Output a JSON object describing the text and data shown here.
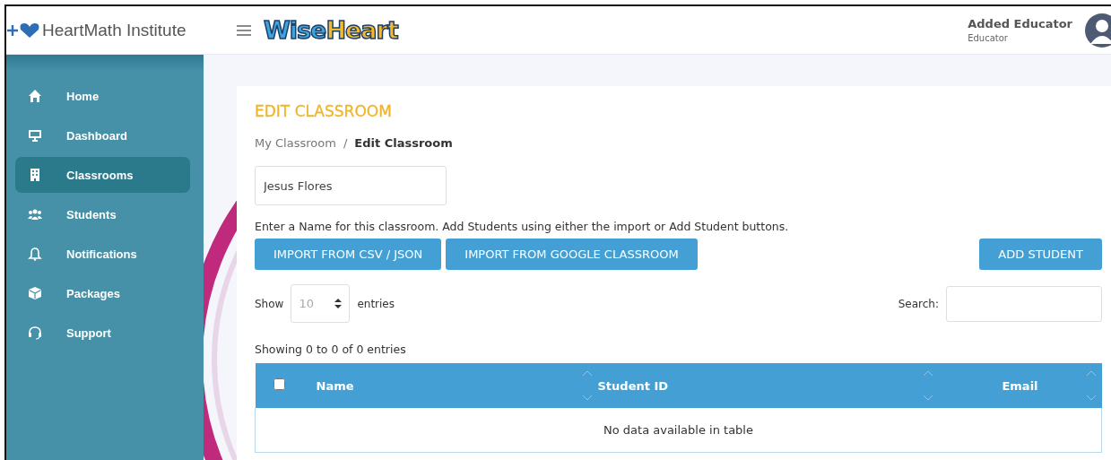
{
  "header": {
    "brand": "HeartMath Institute",
    "app_logo": {
      "first": "Wise",
      "second": "Heart"
    },
    "user": {
      "name": "Added Educator",
      "role": "Educator"
    }
  },
  "sidebar": {
    "items": [
      {
        "label": "Home",
        "selected": false
      },
      {
        "label": "Dashboard",
        "selected": false
      },
      {
        "label": "Classrooms",
        "selected": true
      },
      {
        "label": "Students",
        "selected": false
      },
      {
        "label": "Notifications",
        "selected": false
      },
      {
        "label": "Packages",
        "selected": false
      },
      {
        "label": "Support",
        "selected": false
      }
    ]
  },
  "page": {
    "title": "EDIT CLASSROOM",
    "breadcrumb": [
      "My Classroom",
      "/",
      "Edit Classroom"
    ],
    "name_field": {
      "value": "Jesus Flores"
    },
    "help_text": "Enter a Name for this classroom. Add Students using either the import or Add Student buttons.",
    "buttons": [
      "IMPORT FROM CSV / JSON",
      "IMPORT FROM GOOGLE CLASSROOM",
      "ADD STUDENT"
    ],
    "length": {
      "before": "Show",
      "value": "10",
      "after": "entries"
    },
    "search_label": "Search:",
    "info": "Showing 0 to 0 of 0 entries",
    "table": {
      "select_all": {
        "checked": false
      },
      "columns": [
        "Name",
        "Student ID",
        "Email"
      ],
      "empty_text": "No data available in table"
    }
  }
}
